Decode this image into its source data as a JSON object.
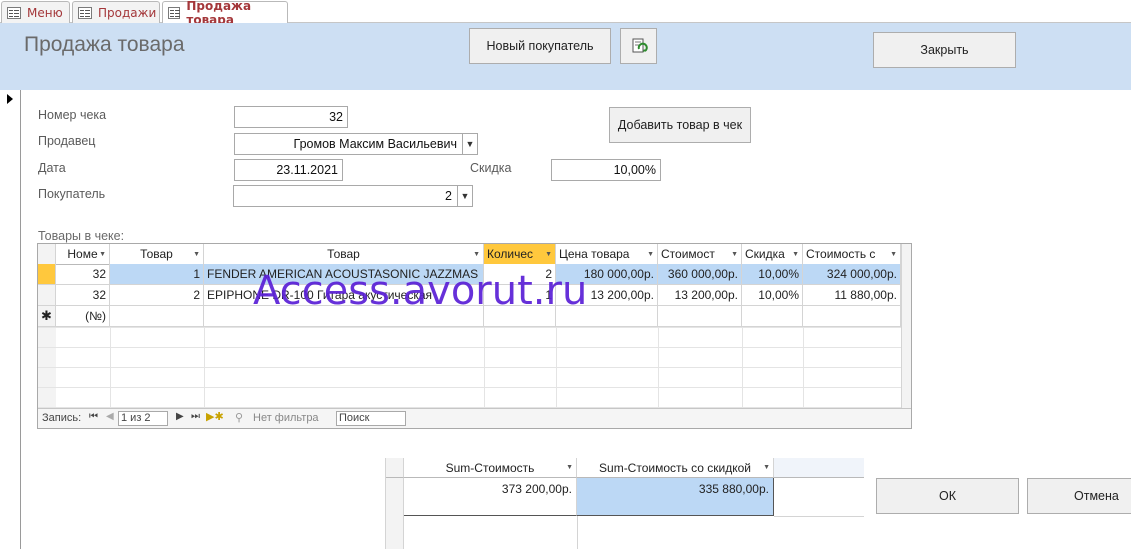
{
  "tabs": [
    {
      "label": "Меню"
    },
    {
      "label": "Продажи"
    },
    {
      "label": "Продажа товара"
    }
  ],
  "header": {
    "title": "Продажа товара",
    "new_customer_label": "Новый покупатель",
    "close_label": "Закрыть",
    "refresh_icon": "refresh-icon"
  },
  "form": {
    "receipt_label": "Номер чека",
    "receipt_value": "32",
    "seller_label": "Продавец",
    "seller_value": "Громов Максим Васильевич",
    "date_label": "Дата",
    "date_value": "23.11.2021",
    "discount_label": "Скидка",
    "discount_value": "10,00%",
    "customer_label": "Покупатель",
    "customer_value": "2",
    "add_item_label": "Добавить товар в чек",
    "items_label": "Товары в чеке:"
  },
  "grid": {
    "columns": [
      "Номе",
      "Товар",
      "Товар",
      "Количес",
      "Цена товара",
      "Стоимост",
      "Скидка",
      "Стоимость с"
    ],
    "rows": [
      [
        "32",
        "1",
        "FENDER AMERICAN ACOUSTASONIC JAZZMAS",
        "2",
        "180 000,00р.",
        "360 000,00р.",
        "10,00%",
        "324 000,00р."
      ],
      [
        "32",
        "2",
        "EPIPHONE DR-100 Гитара акустическая",
        "1",
        "13 200,00р.",
        "13 200,00р.",
        "10,00%",
        "11 880,00р."
      ]
    ],
    "new_row_marker": "(№)",
    "nav": {
      "record_label": "Запись:",
      "position": "1 из 2",
      "no_filter": "Нет фильтра",
      "search": "Поиск"
    }
  },
  "watermark": "Access.avorut.ru",
  "sum_grid": {
    "columns": [
      "Sum-Стоимость",
      "Sum-Стоимость со скидкой"
    ],
    "values": [
      "373 200,00р.",
      "335 880,00р."
    ]
  },
  "buttons": {
    "ok": "ОК",
    "cancel": "Отмена"
  },
  "colors": {
    "header_bg": "#cddff3",
    "selected_row": "#bcd8f5",
    "active_col_header": "#ffc83d",
    "watermark": "#5a1fd6"
  }
}
